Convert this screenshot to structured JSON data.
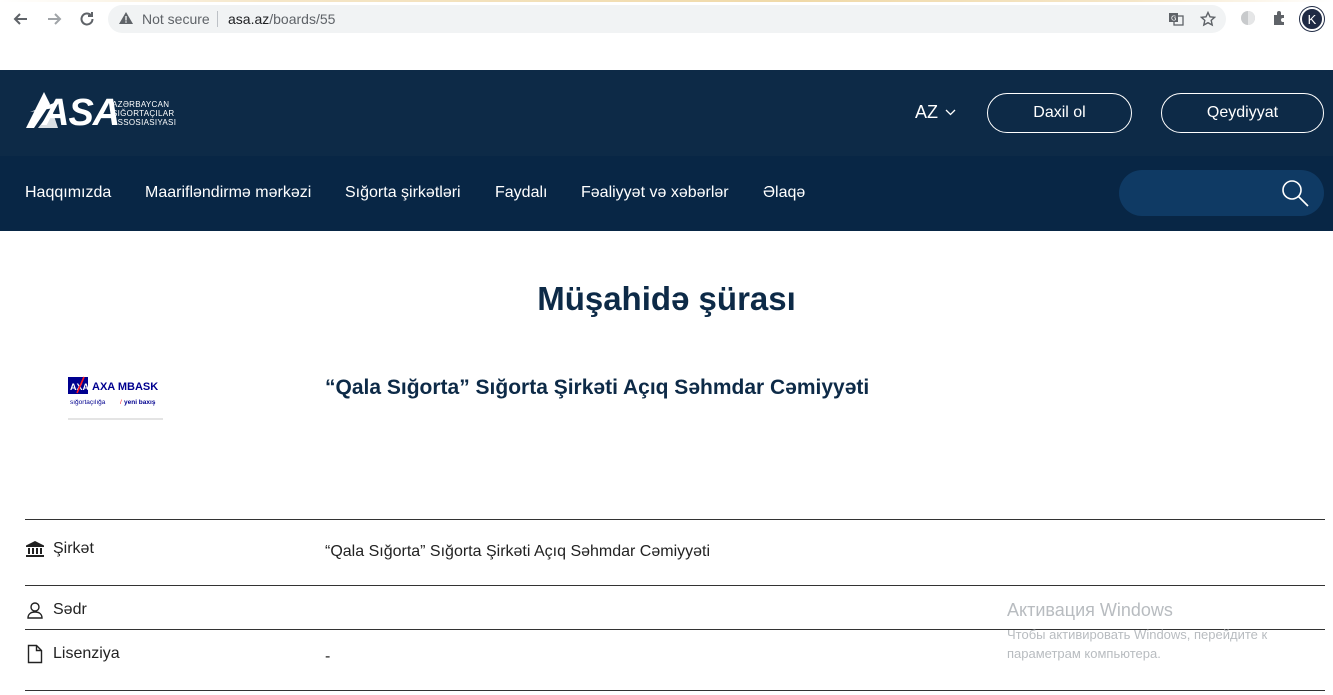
{
  "browser": {
    "security_label": "Not secure",
    "url_host": "asa.az",
    "url_path": "/boards/55",
    "profile_initial": "K"
  },
  "header": {
    "logo_text": "ASA",
    "logo_sub_line1": "AZƏRBAYCAN",
    "logo_sub_line2": "SIĞORTAÇILAR",
    "logo_sub_line3": "ASSOSIASIYASI",
    "language": "AZ",
    "login_label": "Daxil ol",
    "register_label": "Qeydiyyat"
  },
  "nav": {
    "items": [
      {
        "label": "Haqqımızda"
      },
      {
        "label": "Maarifləndirmə mərkəzi"
      },
      {
        "label": "Sığorta şirkətləri"
      },
      {
        "label": "Faydalı"
      },
      {
        "label": "Fəaliyyət və xəbərlər"
      },
      {
        "label": "Əlaqə"
      }
    ],
    "search_placeholder": ""
  },
  "page": {
    "title": "Müşahidə şürası",
    "company_logo_text": "AXA MBASK",
    "company_logo_tagline_a": "sığortaçılığa",
    "company_logo_tagline_b": "yeni baxış",
    "company_name": "“Qala Sığorta” Sığorta Şirkəti Açıq Səhmdar Cəmiyyəti"
  },
  "details": {
    "company_label": "Şirkət",
    "company_value": "“Qala Sığorta” Sığorta Şirkəti Açıq Səhmdar Cəmiyyəti",
    "chairman_label": "Sədr",
    "chairman_value": "",
    "license_label": "Lisenziya",
    "license_value": "-"
  },
  "watermark": {
    "line1": "Активация Windows",
    "line2": "Чтобы активировать Windows, перейдите к параметрам компьютера."
  },
  "colors": {
    "header_bg": "#0d2a47",
    "nav_bg": "#082645",
    "title_color": "#0d2a47",
    "axa_blue": "#00008f",
    "axa_red": "#ff1721"
  }
}
